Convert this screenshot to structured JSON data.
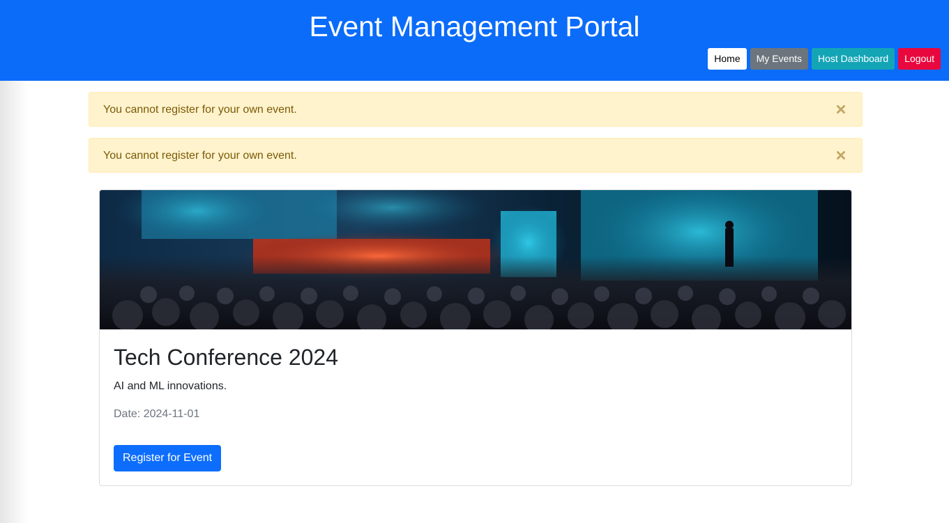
{
  "header": {
    "title": "Event Management Portal",
    "nav": {
      "home": "Home",
      "my_events": "My Events",
      "host_dashboard": "Host Dashboard",
      "logout": "Logout"
    }
  },
  "alerts": [
    {
      "message": "You cannot register for your own event.",
      "close_icon": "close-icon"
    },
    {
      "message": "You cannot register for your own event.",
      "close_icon": "close-icon"
    }
  ],
  "event": {
    "image": "conference-crowd-image",
    "title": "Tech Conference 2024",
    "description": "AI and ML innovations.",
    "date_text": "Date: 2024-11-01",
    "register_label": "Register for Event"
  },
  "colors": {
    "header_bg": "#0a6cf9",
    "primary": "#0d6efd",
    "secondary": "#6c757d",
    "info": "#13a5b6",
    "danger": "#e8083e",
    "warning_bg": "#fff3cd"
  }
}
